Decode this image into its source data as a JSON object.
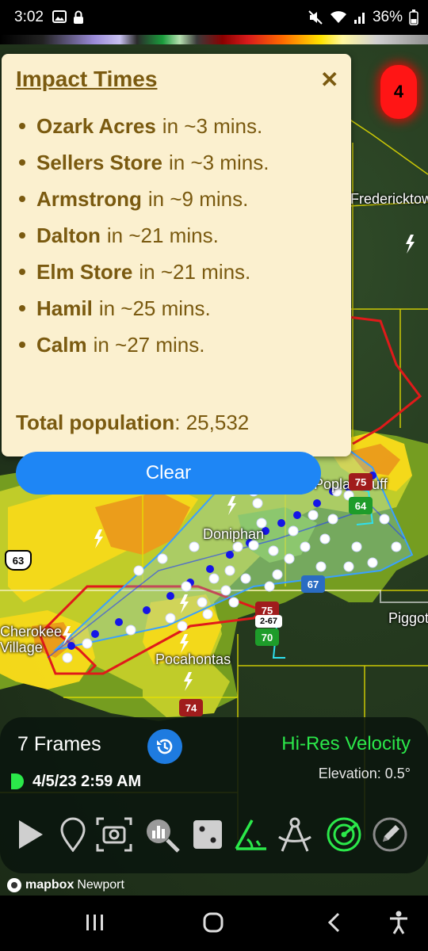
{
  "status_bar": {
    "time": "3:02",
    "battery": "36%",
    "left_icons": [
      "image-icon",
      "lock-icon"
    ],
    "right_icons": [
      "mute-icon",
      "wifi-icon",
      "signal-icon",
      "battery-icon"
    ]
  },
  "impact_panel": {
    "title": "Impact Times",
    "items": [
      {
        "place": "Ozark Acres",
        "time": "in ~3 mins."
      },
      {
        "place": "Sellers Store",
        "time": "in ~3 mins."
      },
      {
        "place": "Armstrong",
        "time": "in ~9 mins."
      },
      {
        "place": "Dalton",
        "time": "in ~21 mins."
      },
      {
        "place": "Elm Store",
        "time": "in ~21 mins."
      },
      {
        "place": "Hamil",
        "time": "in ~25 mins."
      },
      {
        "place": "Calm",
        "time": "in ~27 mins."
      }
    ],
    "population_label": "Total population",
    "population_value": ": 25,532",
    "clear_label": "Clear"
  },
  "alert_badge": {
    "count": "4",
    "color": "#ff1515"
  },
  "map": {
    "labels": {
      "fredericktown": "Fredericktown",
      "poplar_bluff": "Poplar Bluff",
      "doniphan": "Doniphan",
      "pocahontas": "Pocahontas",
      "cherokee_village": "Cherokee Village",
      "piggott": "Piggott"
    },
    "shields": {
      "us63": "63",
      "r67": "67",
      "r75a": "75",
      "r75b": "75",
      "r64": "64",
      "r70": "70",
      "r74": "74",
      "r267": "2-67"
    }
  },
  "player": {
    "frames_label": "7 Frames",
    "product": "Hi-Res Velocity",
    "elevation": "Elevation: 0.5°",
    "timestamp": "4/5/23 2:59 AM",
    "accent_color": "#2be84a",
    "tools": [
      "play-icon",
      "location-pin-icon",
      "camera-icon",
      "search-chart-icon",
      "dice-icon",
      "angle-icon",
      "compass-icon",
      "radar-icon",
      "pencil-icon"
    ]
  },
  "attribution": {
    "brand": "mapbox",
    "place": "Newport"
  },
  "nav_bar": {
    "items": [
      "recents-icon",
      "home-icon",
      "back-icon",
      "accessibility-icon"
    ]
  }
}
